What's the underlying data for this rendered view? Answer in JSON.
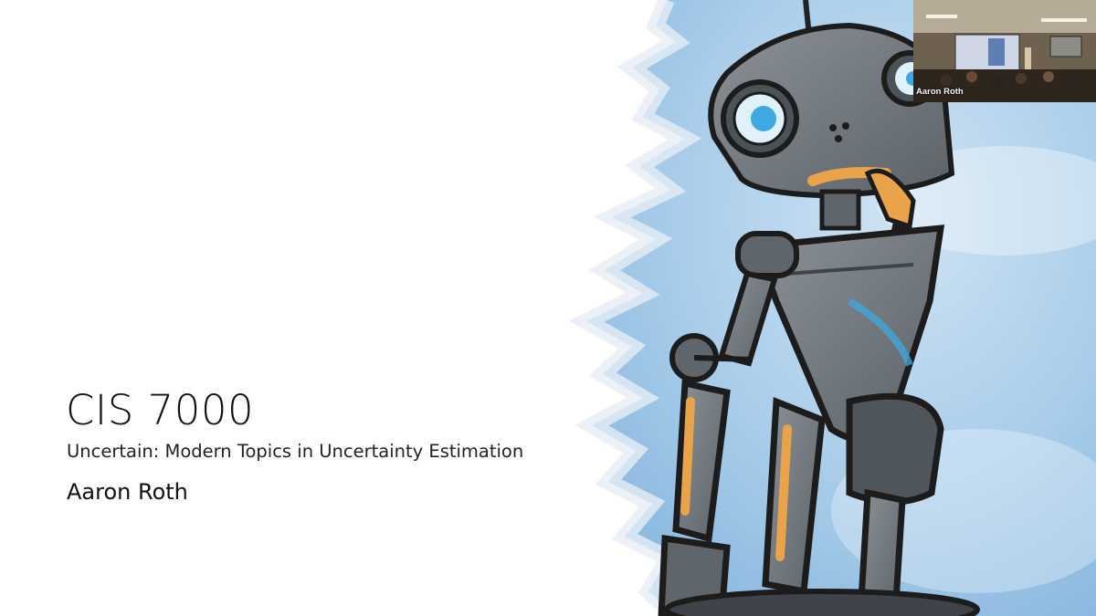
{
  "slide": {
    "course_code": "CIS 7000",
    "subtitle": "Uncertain: Modern Topics in Uncertainty Estimation",
    "author": "Aaron Roth",
    "illustration_icon": "thinking-robot-icon"
  },
  "participant": {
    "name_label": "Aaron Roth"
  },
  "colors": {
    "background": "#ffffff",
    "sky": "#a9cdea",
    "robot_body": "#6f767c",
    "robot_accent": "#e9a44a",
    "eye_blue": "#3ea9e0"
  }
}
